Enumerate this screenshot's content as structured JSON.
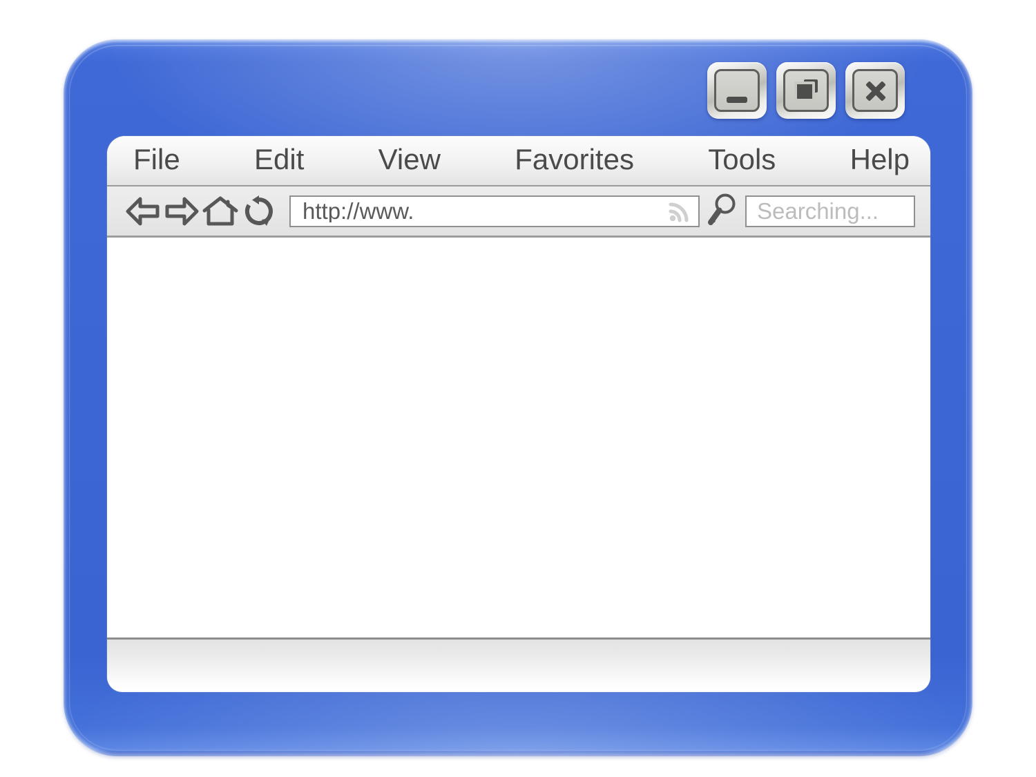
{
  "window": {
    "frame_color": "#3c66d4",
    "controls": [
      {
        "name": "minimize",
        "glyph": "minimize-icon",
        "label": "Minimize"
      },
      {
        "name": "restore",
        "glyph": "restore-icon",
        "label": "Restore Down"
      },
      {
        "name": "close",
        "glyph": "close-icon",
        "label": "Close"
      }
    ]
  },
  "menu": {
    "items": [
      {
        "label": "File"
      },
      {
        "label": "Edit"
      },
      {
        "label": "View"
      },
      {
        "label": "Favorites"
      },
      {
        "label": "Tools"
      },
      {
        "label": "Help"
      }
    ]
  },
  "toolbar": {
    "nav": [
      {
        "name": "back",
        "icon": "arrow-left-icon",
        "label": "Back"
      },
      {
        "name": "forward",
        "icon": "arrow-right-icon",
        "label": "Forward"
      },
      {
        "name": "home",
        "icon": "home-icon",
        "label": "Home"
      },
      {
        "name": "refresh",
        "icon": "refresh-icon",
        "label": "Refresh"
      }
    ],
    "address": {
      "value": "http://www.",
      "placeholder": "http://www.",
      "feed_icon": "rss-icon"
    },
    "search": {
      "icon": "magnifier-icon",
      "value": "",
      "placeholder": "Searching...",
      "display_text": "Searching..."
    }
  },
  "page": {
    "content": ""
  },
  "status_bar": {
    "text": ""
  },
  "colors": {
    "frame_blue": "#3c66d4",
    "frame_blue_light": "#5a85e4",
    "chrome_gray": "#e9e9e9",
    "icon_gray": "#575757",
    "placeholder_gray": "#bcbcbc",
    "text_gray": "#4a4a4a"
  }
}
